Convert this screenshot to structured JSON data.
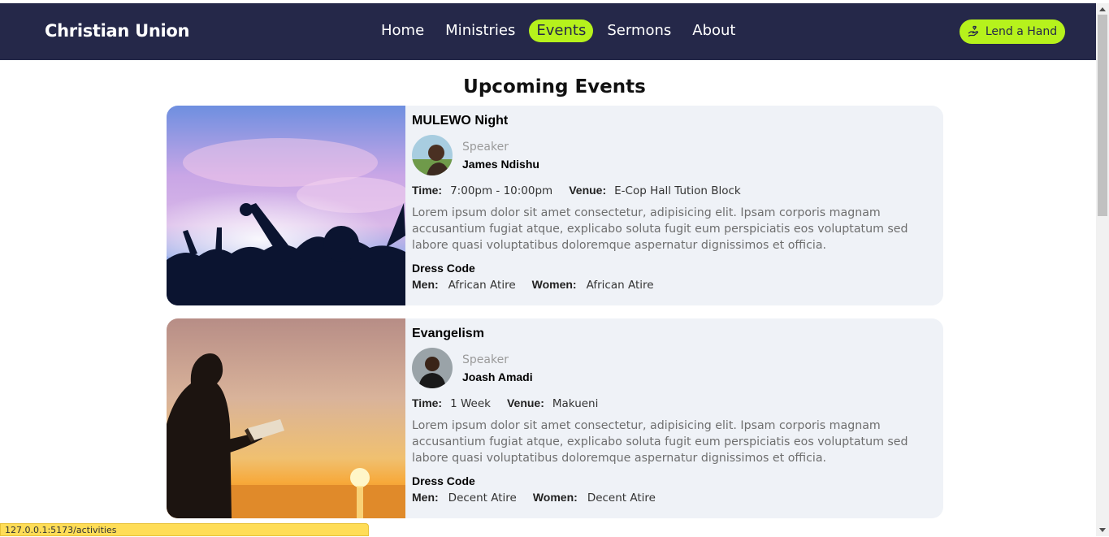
{
  "brand": "Christian Union",
  "nav": {
    "items": [
      "Home",
      "Ministries",
      "Events",
      "Sermons",
      "About"
    ],
    "active": "Events"
  },
  "lend_button": "Lend a Hand",
  "heading": "Upcoming Events",
  "labels": {
    "speaker": "Speaker",
    "time": "Time:",
    "venue": "Venue:",
    "dress_code": "Dress Code",
    "men": "Men:",
    "women": "Women:"
  },
  "events": [
    {
      "title": "MULEWO Night",
      "speaker": "James Ndishu",
      "time": "7:00pm - 10:00pm",
      "venue": "E-Cop Hall Tution Block",
      "description": "Lorem ipsum dolor sit amet consectetur, adipisicing elit. Ipsam corporis magnam accusantium fugiat atque, explicabo soluta fugit eum perspiciatis eos voluptatum sed labore quasi voluptatibus doloremque aspernatur dignissimos et officia.",
      "men": "African Atire",
      "women": "African Atire"
    },
    {
      "title": "Evangelism",
      "speaker": "Joash Amadi",
      "time": "1 Week",
      "venue": "Makueni",
      "description": "Lorem ipsum dolor sit amet consectetur, adipisicing elit. Ipsam corporis magnam accusantium fugiat atque, explicabo soluta fugit eum perspiciatis eos voluptatum sed labore quasi voluptatibus doloremque aspernatur dignissimos et officia.",
      "men": "Decent Atire",
      "women": "Decent Atire"
    }
  ],
  "status_url": "127.0.0.1:5173/activities",
  "colors": {
    "navbar": "#252849",
    "accent": "#b6f21c",
    "card": "#eff2f7",
    "status": "#ffdd57"
  }
}
